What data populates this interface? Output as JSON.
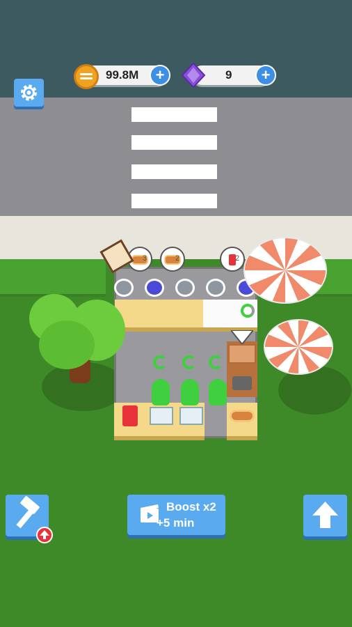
{
  "hud": {
    "coins_value": "99.8M",
    "gems_value": "9",
    "plus_symbol": "+",
    "coin_icon": "coin-icon",
    "gem_icon": "gem-icon",
    "settings_icon": "gear-icon"
  },
  "scene": {
    "customer_orders": [
      "hot-dog",
      "hot-dog",
      "soda"
    ],
    "order_counts": [
      "3",
      "2",
      "2"
    ]
  },
  "bottom_bar": {
    "boost_line1": "Boost x2",
    "boost_line2": "+5 min",
    "hammer_icon": "hammer-icon",
    "video_icon": "video-icon",
    "upgrade_icon": "up-arrow-icon"
  },
  "colors": {
    "button_blue": "#5aaaf0",
    "grass": "#3f8a28",
    "road": "#8e8e92",
    "coin": "#f0a221",
    "gem": "#8a4fd8",
    "badge_red": "#e8323a"
  }
}
